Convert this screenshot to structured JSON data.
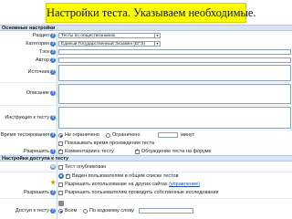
{
  "banner": {
    "title": "Настройки теста. Указываем необходимые."
  },
  "sections": {
    "basic": "Основные настройки",
    "access": "Настройки доступа к тесту"
  },
  "fields": {
    "section_label": "Раздел",
    "section_value": "Тесты по обществознанию",
    "category_label": "Категория",
    "category_value": "Единый Государственный Экзамен (ЕГЭ)",
    "tags_label": "Тэги",
    "author_label": "Автор",
    "source_label": "Источник",
    "description_label": "Описание",
    "instruction_label": "Инструкция к тесту"
  },
  "time": {
    "label": "Время тестирования",
    "opt_unlimited": "Не ограничено",
    "opt_limited": "Ограничено",
    "unit": "минут",
    "show_time": "Показывать время прохождения теста"
  },
  "comments": {
    "label": "Разрешить",
    "opt_comments": "Комментарии к тесту",
    "opt_discuss": "Обсуждение теста на форуме"
  },
  "access": {
    "published": "Тест опубликован",
    "visible": "Виден пользователям в общем списке тестов",
    "allow_other_sites": "Разрешить использование на других сайтах",
    "allow_other_sites_link": "(управление)",
    "allow_research": "Разрешить пользователям проводить собственные исследования",
    "allow_label": "Разрешить",
    "access_label": "Доступ к тесту",
    "opt_all": "Всем",
    "opt_code": "По кодовому слову"
  }
}
